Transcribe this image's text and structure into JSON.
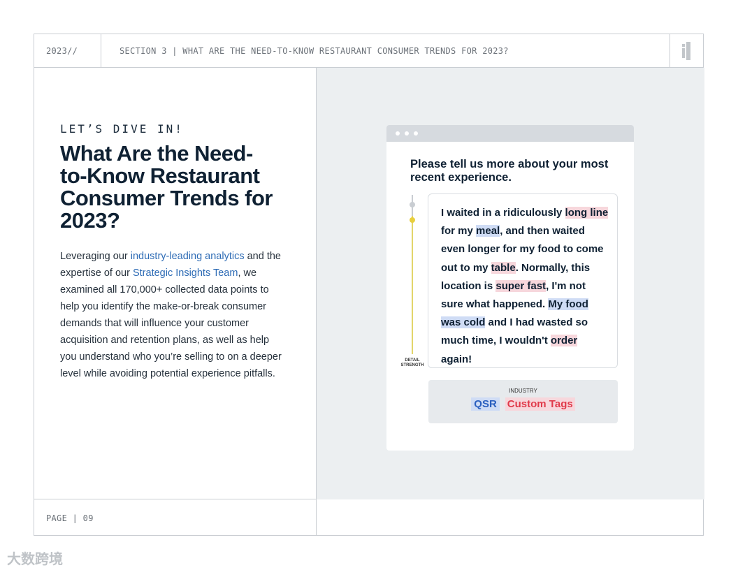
{
  "header": {
    "year": "2023//",
    "section": "SECTION 3 | WHAT ARE THE NEED-TO-KNOW RESTAURANT CONSUMER TRENDS FOR 2023?"
  },
  "left": {
    "eyebrow": "LET’S DIVE IN!",
    "title": "What Are the Need-to-Know Restaurant Consumer Trends for 2023?",
    "body_before_link1": "Leveraging our ",
    "link1": "industry-leading analytics",
    "body_between": " and the expertise of our ",
    "link2": "Strategic Insights Team",
    "body_after": ", we examined all 170,000+ collected data points to help you identify the make-or-break consumer demands that will influence your customer acquisition and retention plans, as well as help you understand who you’re selling to on a deeper level while avoiding potential experience pitfalls."
  },
  "footer": {
    "page": "PAGE | 09"
  },
  "survey": {
    "question": "Please tell us more about your most recent experience.",
    "detail_label": "DETAIL STRENGTH",
    "response": [
      {
        "t": "I waited in a ridiculously ",
        "h": ""
      },
      {
        "t": "long line",
        "h": "red"
      },
      {
        "t": " for my ",
        "h": ""
      },
      {
        "t": "meal",
        "h": "blue"
      },
      {
        "t": ", and then waited even longer for my food to come out to my ",
        "h": ""
      },
      {
        "t": "table",
        "h": "red"
      },
      {
        "t": ". Normally, this location is ",
        "h": ""
      },
      {
        "t": "super fast",
        "h": "red"
      },
      {
        "t": ", I'm not sure what happened. ",
        "h": ""
      },
      {
        "t": "My food was cold",
        "h": "blue"
      },
      {
        "t": " and I had wasted so much time, I wouldn't ",
        "h": ""
      },
      {
        "t": "order",
        "h": "red"
      },
      {
        "t": " again!",
        "h": ""
      }
    ],
    "industry_label": "INDUSTRY",
    "tag_industry": "QSR",
    "tag_custom": "Custom Tags"
  },
  "watermark": "大数跨境",
  "colors": {
    "link": "#2d6bb5",
    "highlight_red": "#f7d7dc",
    "highlight_blue": "#cfdcf5",
    "panel": "#eceff1"
  }
}
